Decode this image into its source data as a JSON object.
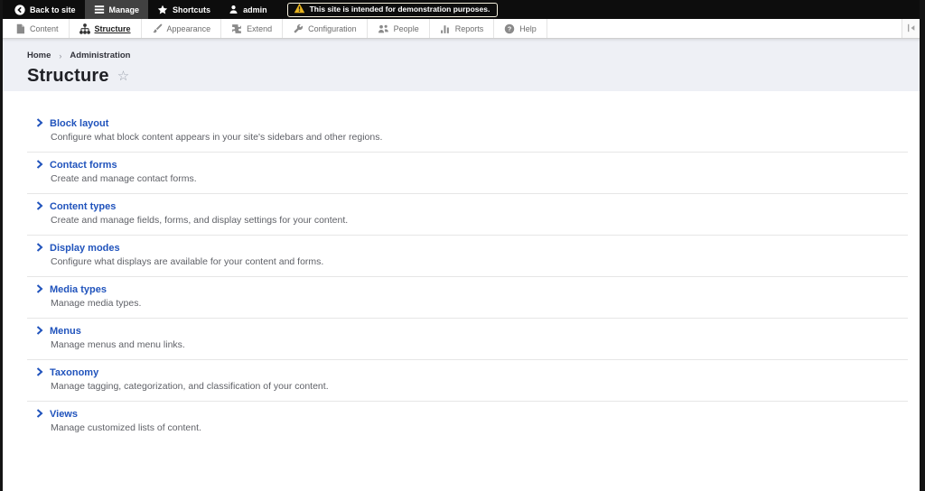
{
  "top_toolbar": {
    "back_to_site": "Back to site",
    "manage": "Manage",
    "shortcuts": "Shortcuts",
    "user": "admin",
    "warning": "This site is intended for demonstration purposes."
  },
  "admin_menu": {
    "items": [
      {
        "label": "Content",
        "icon": "document-icon"
      },
      {
        "label": "Structure",
        "icon": "sitemap-icon",
        "active": true
      },
      {
        "label": "Appearance",
        "icon": "paintbrush-icon"
      },
      {
        "label": "Extend",
        "icon": "puzzle-icon"
      },
      {
        "label": "Configuration",
        "icon": "wrench-icon"
      },
      {
        "label": "People",
        "icon": "people-icon"
      },
      {
        "label": "Reports",
        "icon": "bar-chart-icon"
      },
      {
        "label": "Help",
        "icon": "help-icon"
      }
    ]
  },
  "breadcrumb": {
    "home": "Home",
    "separator": "›",
    "current": "Administration"
  },
  "page": {
    "title": "Structure",
    "favorite_star": "☆"
  },
  "sections": [
    {
      "title": "Block layout",
      "description": "Configure what block content appears in your site's sidebars and other regions."
    },
    {
      "title": "Contact forms",
      "description": "Create and manage contact forms."
    },
    {
      "title": "Content types",
      "description": "Create and manage fields, forms, and display settings for your content."
    },
    {
      "title": "Display modes",
      "description": "Configure what displays are available for your content and forms."
    },
    {
      "title": "Media types",
      "description": "Manage media types."
    },
    {
      "title": "Menus",
      "description": "Manage menus and menu links."
    },
    {
      "title": "Taxonomy",
      "description": "Manage tagging, categorization, and classification of your content."
    },
    {
      "title": "Views",
      "description": "Manage customized lists of content."
    }
  ],
  "colors": {
    "link_blue": "#2053bc",
    "toolbar_bg": "#0d0d0d",
    "active_tab_bg": "#414141",
    "header_bg": "#eef0f5",
    "warning_yellow": "#e8b41f"
  }
}
